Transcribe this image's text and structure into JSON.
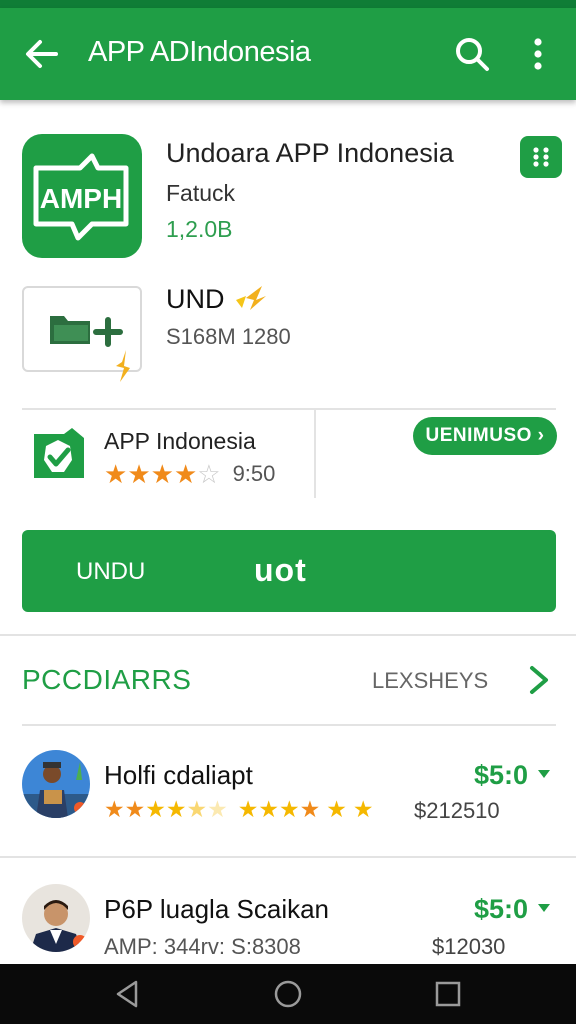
{
  "header": {
    "title": "APP ADIndonesia",
    "back_icon": "arrow-left-icon",
    "search_icon": "search-icon",
    "menu_icon": "more-vert-icon"
  },
  "app": {
    "icon_text": "AMPH",
    "name": "Undoara APP Indonesia",
    "developer": "Fatuck",
    "size": "1,2.0B",
    "grid_icon": "grid-icon"
  },
  "secondary": {
    "label": "UND",
    "subtitle": "S168M 1280",
    "file_icon": "folder-add-icon"
  },
  "rating": {
    "title": "APP Indonesia",
    "stars_filled": 4,
    "stars_total": 5,
    "value": "9:50",
    "pill_button": "UENIMUSO ›"
  },
  "install": {
    "left_label": "UNDU",
    "center_label": "uot"
  },
  "section": {
    "title": "PCCDIARRS",
    "link": "LEXSHEYS",
    "chevron_icon": "chevron-right-icon"
  },
  "reviews": [
    {
      "name": "Holfi cdaliapt",
      "price": "$5:0",
      "amount": "$212510",
      "avatar_icon": "avatar-courier"
    },
    {
      "name": "P6P luagla Scaikan",
      "price": "$5:0",
      "meta": "AMP: 344rv: S:8308",
      "amount": "$12030",
      "avatar_icon": "avatar-man"
    }
  ],
  "colors": {
    "primary": "#1f9e45",
    "star_orange": "#f08a1a",
    "star_gold": "#f5b800"
  }
}
